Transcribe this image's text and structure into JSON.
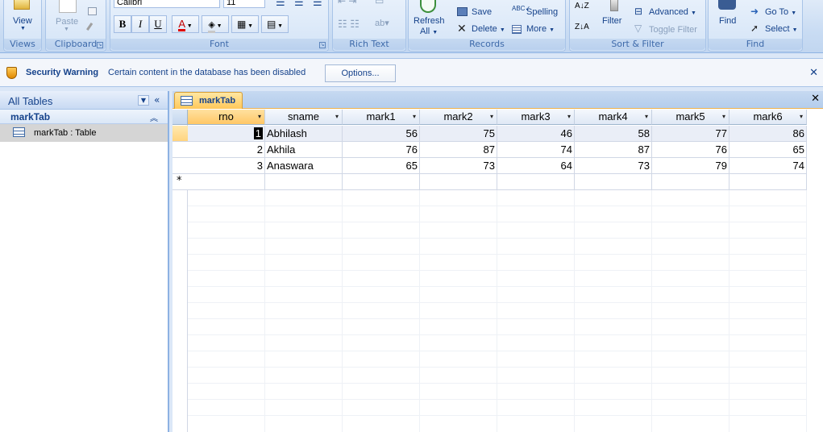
{
  "ribbon": {
    "views": {
      "view_label": "View",
      "group_label": "Views"
    },
    "clipboard": {
      "paste_label": "Paste",
      "group_label": "Clipboard"
    },
    "font": {
      "font_name": "Calibri",
      "font_size": "11",
      "bold": "B",
      "italic": "I",
      "underline": "U",
      "group_label": "Font"
    },
    "rich_text": {
      "group_label": "Rich Text"
    },
    "records": {
      "refresh_label": "Refresh",
      "refresh_sub": "All",
      "save_label": "Save",
      "delete_label": "Delete",
      "spelling_label": "Spelling",
      "more_label": "More",
      "group_label": "Records"
    },
    "sort_filter": {
      "filter_label": "Filter",
      "advanced_label": "Advanced",
      "toggle_filter_label": "Toggle Filter",
      "group_label": "Sort & Filter"
    },
    "find": {
      "find_label": "Find",
      "goto_label": "Go To",
      "select_label": "Select",
      "group_label": "Find"
    }
  },
  "security_bar": {
    "title": "Security Warning",
    "message": "Certain content in the database has been disabled",
    "options_label": "Options..."
  },
  "nav_pane": {
    "header": "All Tables",
    "group": "markTab",
    "items": [
      {
        "label": "markTab : Table"
      }
    ]
  },
  "document": {
    "tab_label": "markTab"
  },
  "table": {
    "columns": [
      "rno",
      "sname",
      "mark1",
      "mark2",
      "mark3",
      "mark4",
      "mark5",
      "mark6"
    ],
    "rows": [
      [
        "1",
        "Abhilash",
        "56",
        "75",
        "46",
        "58",
        "77",
        "86"
      ],
      [
        "2",
        "Akhila",
        "76",
        "87",
        "74",
        "87",
        "76",
        "65"
      ],
      [
        "3",
        "Anaswara",
        "65",
        "73",
        "64",
        "73",
        "79",
        "74"
      ]
    ],
    "new_row_marker": "*"
  },
  "colors": {
    "ribbon_text": "#15428b",
    "active_tab": "#ffc85a",
    "header_bg": "#dfe8f5"
  }
}
